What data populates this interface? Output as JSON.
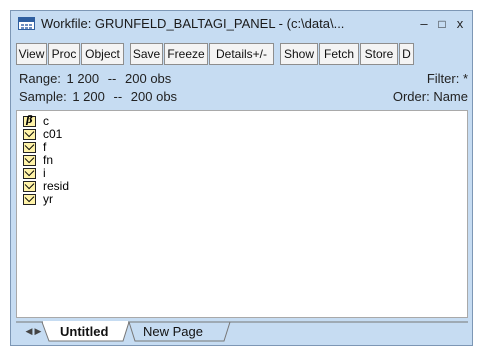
{
  "title": "Workfile: GRUNFELD_BALTAGI_PANEL - (c:\\data\\...",
  "window_controls": {
    "minimize": "–",
    "restore": "□",
    "close": "x"
  },
  "toolbar": {
    "buttons": [
      "View",
      "Proc",
      "Object",
      "Save",
      "Freeze",
      "Details+/-",
      "Show",
      "Fetch",
      "Store",
      "D"
    ]
  },
  "info": {
    "range_label": "Range:",
    "range_value": "1 200",
    "range_sep": "--",
    "range_obs": "200 obs",
    "filter": "Filter: *",
    "sample_label": "Sample:",
    "sample_value": "1 200",
    "sample_sep": "--",
    "sample_obs": "200 obs",
    "order": "Order: Name"
  },
  "objects": [
    {
      "name": "c",
      "icon": "coefficient-beta-icon",
      "icon_glyph": "β"
    },
    {
      "name": "c01",
      "icon": "series-icon"
    },
    {
      "name": "f",
      "icon": "series-icon"
    },
    {
      "name": "fn",
      "icon": "series-icon"
    },
    {
      "name": "i",
      "icon": "series-icon"
    },
    {
      "name": "resid",
      "icon": "series-icon"
    },
    {
      "name": "yr",
      "icon": "series-icon"
    }
  ],
  "tabs": {
    "scroll_left": "◀",
    "scroll_right": "▶",
    "items": [
      "Untitled",
      "New Page"
    ],
    "active": "Untitled"
  },
  "colors": {
    "window_frame": "#c6dcf2",
    "icon_fill": "#fff3a8"
  }
}
